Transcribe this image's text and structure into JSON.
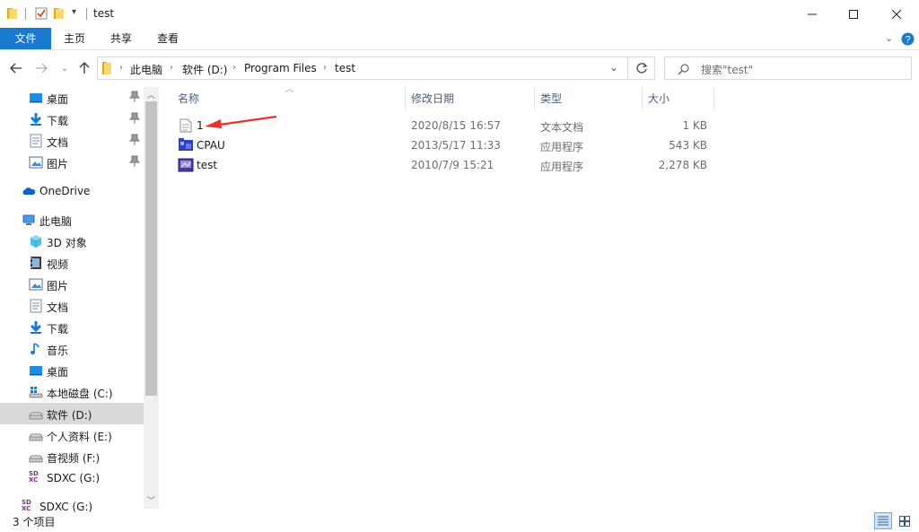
{
  "window": {
    "title": "test"
  },
  "ribbon": {
    "tabs": [
      "文件",
      "主页",
      "共享",
      "查看"
    ]
  },
  "address": {
    "crumbs": [
      "此电脑",
      "软件 (D:)",
      "Program Files",
      "test"
    ]
  },
  "search": {
    "placeholder": "搜索\"test\""
  },
  "nav": {
    "quick_access": [
      {
        "label": "桌面",
        "icon": "desktop-icon"
      },
      {
        "label": "下载",
        "icon": "download-icon"
      },
      {
        "label": "文档",
        "icon": "document-icon"
      },
      {
        "label": "图片",
        "icon": "picture-icon"
      }
    ],
    "onedrive": "OneDrive",
    "this_pc": "此电脑",
    "pc_items": [
      {
        "label": "3D 对象",
        "icon": "3d-objects-icon"
      },
      {
        "label": "视频",
        "icon": "video-icon"
      },
      {
        "label": "图片",
        "icon": "picture-icon"
      },
      {
        "label": "文档",
        "icon": "document-icon"
      },
      {
        "label": "下载",
        "icon": "download-icon"
      },
      {
        "label": "音乐",
        "icon": "music-icon"
      },
      {
        "label": "桌面",
        "icon": "desktop-icon"
      },
      {
        "label": "本地磁盘 (C:)",
        "icon": "windows-drive-icon"
      },
      {
        "label": "软件 (D:)",
        "icon": "drive-icon"
      },
      {
        "label": "个人资料 (E:)",
        "icon": "drive-icon"
      },
      {
        "label": "音视频 (F:)",
        "icon": "drive-icon"
      },
      {
        "label": "SDXC (G:)",
        "icon": "sd-card-icon"
      }
    ],
    "sdxc_root": "SDXC (G:)",
    "sd_icon_text": "SD XC"
  },
  "columns": {
    "name": "名称",
    "date": "修改日期",
    "type": "类型",
    "size": "大小"
  },
  "files": [
    {
      "name": "1",
      "date": "2020/8/15 16:57",
      "type": "文本文档",
      "size": "1 KB",
      "icon": "text-file-icon"
    },
    {
      "name": "CPAU",
      "date": "2013/5/17 11:33",
      "type": "应用程序",
      "size": "543 KB",
      "icon": "app-icon"
    },
    {
      "name": "test",
      "date": "2010/7/9 15:21",
      "type": "应用程序",
      "size": "2,278 KB",
      "icon": "app-icon"
    }
  ],
  "status": {
    "item_count": "3 个项目"
  },
  "colors": {
    "accent": "#1979ca",
    "selected": "#d9d9d9",
    "arrow": "#e8312f"
  }
}
